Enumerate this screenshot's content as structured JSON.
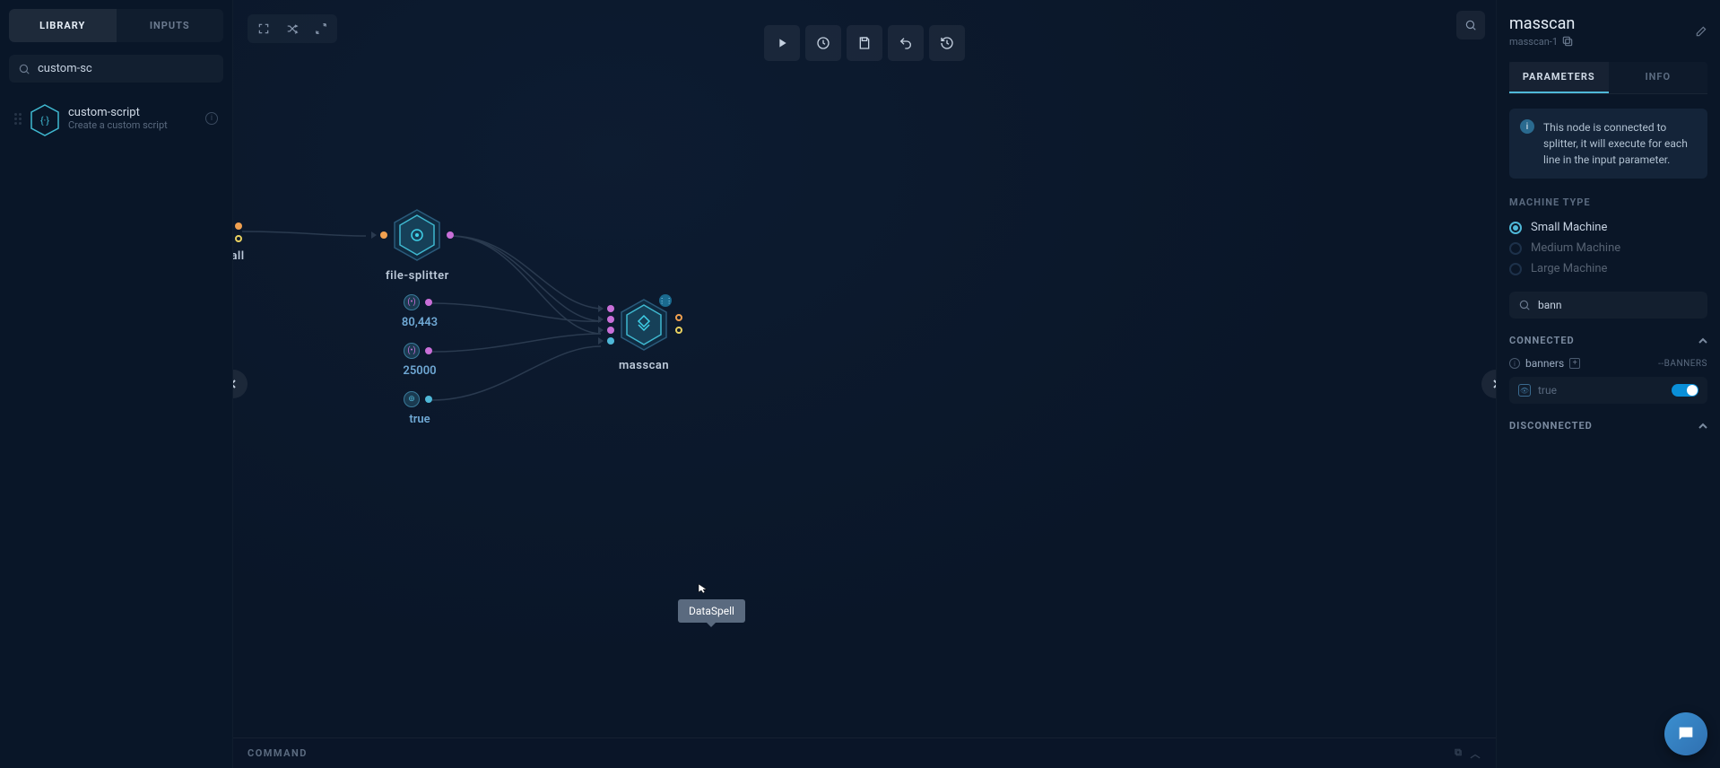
{
  "sidebar_left": {
    "tabs": {
      "library": "LIBRARY",
      "inputs": "INPUTS"
    },
    "search_value": "custom-sc",
    "items": [
      {
        "title": "custom-script",
        "subtitle": "Create a custom script"
      }
    ]
  },
  "canvas": {
    "nodes": {
      "t_all": "t-all",
      "file_splitter": "file-splitter",
      "ports_80_443": "80,443",
      "rate_25000": "25000",
      "true_val": "true",
      "masscan": "masscan"
    },
    "command_label": "COMMAND",
    "tooltip": "DataSpell"
  },
  "sidebar_right": {
    "title": "masscan",
    "id": "masscan-1",
    "tabs": {
      "parameters": "PARAMETERS",
      "info": "INFO"
    },
    "notice": "This node is connected to splitter, it will execute for each line in the input parameter.",
    "machine_type_label": "MACHINE TYPE",
    "machines": {
      "small": "Small Machine",
      "medium": "Medium Machine",
      "large": "Large Machine"
    },
    "param_search_value": "bann",
    "connected_label": "CONNECTED",
    "disconnected_label": "DISCONNECTED",
    "param_banners": {
      "name": "banners",
      "flag": "--BANNERS",
      "value": "true"
    }
  }
}
